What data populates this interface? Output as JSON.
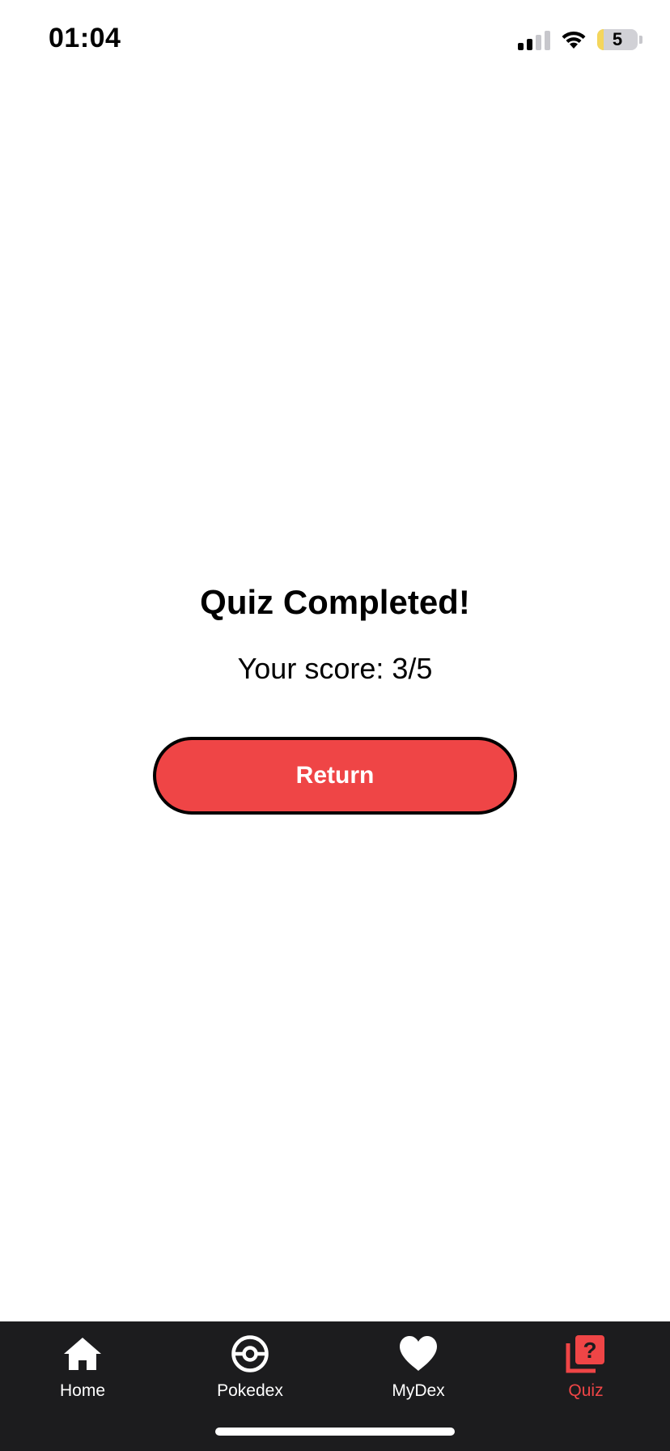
{
  "status_bar": {
    "time": "01:04",
    "battery_level": "5",
    "icons": [
      "signal-icon",
      "wifi-icon",
      "battery-icon"
    ]
  },
  "result": {
    "title": "Quiz Completed!",
    "score_text": "Your score: 3/5",
    "return_label": "Return"
  },
  "tab_bar": {
    "tabs": [
      {
        "label": "Home",
        "icon": "home-icon",
        "active": false
      },
      {
        "label": "Pokedex",
        "icon": "pokeball-icon",
        "active": false
      },
      {
        "label": "MyDex",
        "icon": "heart-icon",
        "active": false
      },
      {
        "label": "Quiz",
        "icon": "quiz-icon",
        "active": true
      }
    ]
  },
  "colors": {
    "accent": "#ef4546",
    "tab_bar_background": "#1c1c1e",
    "background": "#ffffff"
  }
}
